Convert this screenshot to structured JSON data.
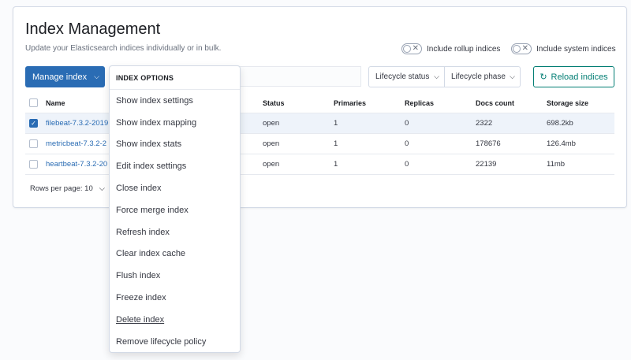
{
  "header": {
    "title": "Index Management",
    "subtitle": "Update your Elasticsearch indices individually or in bulk."
  },
  "toggles": {
    "rollup": {
      "label": "Include rollup indices",
      "on": false
    },
    "system": {
      "label": "Include system indices",
      "on": false
    }
  },
  "toolbar": {
    "manage_label": "Manage index",
    "lifecycle_status": "Lifecycle status",
    "lifecycle_phase": "Lifecycle phase",
    "reload_label": "Reload indices"
  },
  "table": {
    "columns": [
      "Name",
      "Status",
      "Primaries",
      "Replicas",
      "Docs count",
      "Storage size"
    ],
    "rows": [
      {
        "name": "filebeat-7.3.2-2019",
        "status": "open",
        "primaries": "1",
        "replicas": "0",
        "docs": "2322",
        "storage": "698.2kb",
        "selected": true
      },
      {
        "name": "metricbeat-7.3.2-2",
        "status": "open",
        "primaries": "1",
        "replicas": "0",
        "docs": "178676",
        "storage": "126.4mb",
        "selected": false
      },
      {
        "name": "heartbeat-7.3.2-20",
        "status": "open",
        "primaries": "1",
        "replicas": "0",
        "docs": "22139",
        "storage": "11mb",
        "selected": false
      }
    ]
  },
  "pagination": {
    "rows_per_page": "Rows per page: 10"
  },
  "menu": {
    "title": "INDEX OPTIONS",
    "items": [
      "Show index settings",
      "Show index mapping",
      "Show index stats",
      "Edit index settings",
      "Close index",
      "Force merge index",
      "Refresh index",
      "Clear index cache",
      "Flush index",
      "Freeze index",
      "Delete index",
      "Remove lifecycle policy"
    ]
  },
  "colors": {
    "primary": "#2a6cb4",
    "secondary": "#017d73",
    "selected_row": "#eef3fa"
  }
}
